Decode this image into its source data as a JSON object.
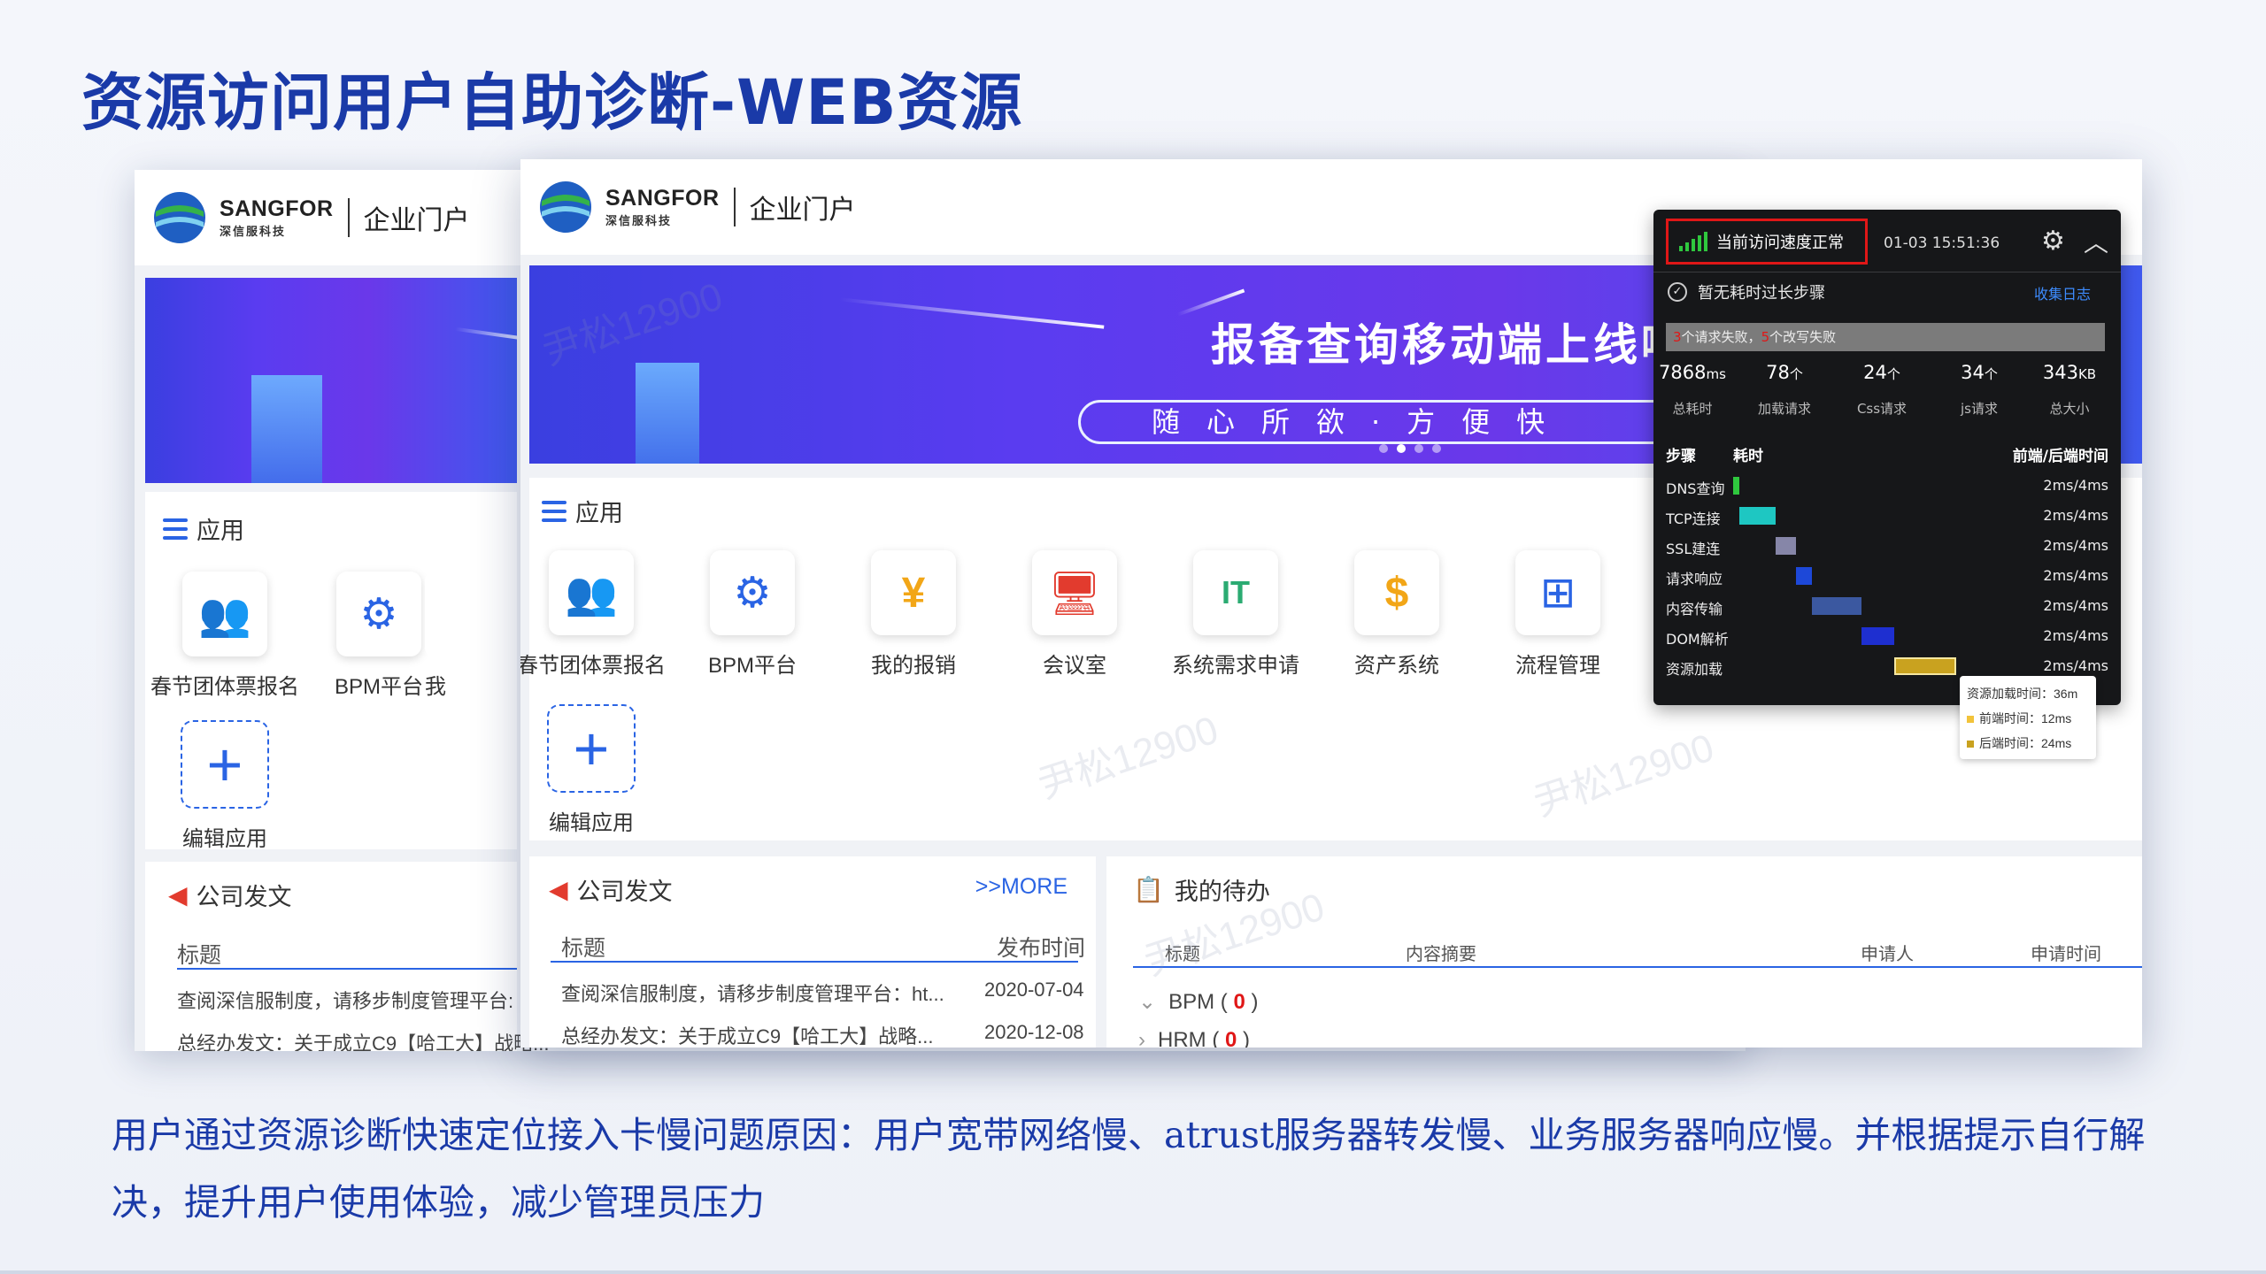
{
  "slide": {
    "title": "资源访问用户自助诊断-WEB资源",
    "caption": "用户通过资源诊断快速定位接入卡慢问题原因：用户宽带网络慢、atrust服务器转发慢、业务服务器响应慢。并根据提示自行解决，提升用户使用体验，减少管理员压力"
  },
  "portal": {
    "brand": "SANGFOR",
    "brand_cn": "深信服科技",
    "portal_name": "企业门户",
    "watermark": "尹松12900",
    "banner": {
      "headline": "报备查询移动端上线啦",
      "subline": "随心所欲·方便快"
    },
    "apps_title": "应用",
    "apps": [
      {
        "label": "春节团体票报名",
        "icon": "people-icon",
        "glyph": "👥",
        "color": "#2a64e4"
      },
      {
        "label": "BPM平台",
        "icon": "bpm-icon",
        "glyph": "⚙",
        "color": "#2a64e4"
      },
      {
        "label": "我的报销",
        "icon": "reimburse-icon",
        "glyph": "¥",
        "color": "#f2a617"
      },
      {
        "label": "会议室",
        "icon": "meeting-room-icon",
        "glyph": "🖥",
        "color": "#e23b2e"
      },
      {
        "label": "系统需求申请",
        "icon": "it-request-icon",
        "glyph": "IT",
        "color": "#2bab72"
      },
      {
        "label": "资产系统",
        "icon": "asset-icon",
        "glyph": "$",
        "color": "#f2a617"
      },
      {
        "label": "流程管理",
        "icon": "workflow-icon",
        "glyph": "⊞",
        "color": "#2a64e4"
      }
    ],
    "edit_app_label": "编辑应用",
    "back_apps": [
      "春节团体票报名",
      "BPM平台",
      "我"
    ],
    "notice": {
      "title": "公司发文",
      "more": ">>MORE",
      "col_title": "标题",
      "col_time": "发布时间",
      "rows": [
        {
          "title": "查阅深信服制度，请移步制度管理平台：ht...",
          "time": "2020-07-04"
        },
        {
          "title": "总经办发文：关于成立C9【哈工大】战略...",
          "time": "2020-12-08"
        }
      ],
      "back_rows": [
        "查阅深信服制度，请移步制度管理平台:",
        "总经办发文：关于成立C9【哈工大】战略..."
      ]
    },
    "todo": {
      "title": "我的待办",
      "columns": [
        "标题",
        "内容摘要",
        "申请人",
        "申请时间"
      ],
      "groups": [
        {
          "name": "BPM",
          "count": "0"
        },
        {
          "name": "HRM",
          "count": "0"
        }
      ]
    }
  },
  "diag": {
    "status": "当前访问速度正常",
    "time": "01-03 15:51:36",
    "no_slow": "暂无耗时过长步骤",
    "collect_log": "收集日志",
    "fail_req_count": "3",
    "fail_req_text": "个请求失败，",
    "fail_rewrite_count": "5",
    "fail_rewrite_text": "个改写失败",
    "stats": [
      {
        "value": "7868",
        "unit": "ms",
        "label": "总耗时"
      },
      {
        "value": "78",
        "unit": "个",
        "label": "加载请求"
      },
      {
        "value": "24",
        "unit": "个",
        "label": "Css请求"
      },
      {
        "value": "34",
        "unit": "个",
        "label": "js请求"
      },
      {
        "value": "343",
        "unit": "KB",
        "label": "总大小"
      }
    ],
    "col_step": "步骤",
    "col_cost": "耗时",
    "col_fb": "前端/后端时间",
    "steps": [
      {
        "name": "DNS查询",
        "time": "2ms/4ms",
        "color": "#2fc83e",
        "start": 0.0,
        "width": 0.02
      },
      {
        "name": "TCP连接",
        "time": "2ms/4ms",
        "color": "#1ec7c2",
        "start": 0.02,
        "width": 0.11
      },
      {
        "name": "SSL建连",
        "time": "2ms/4ms",
        "color": "#8686a8",
        "start": 0.13,
        "width": 0.06
      },
      {
        "name": "请求响应",
        "time": "2ms/4ms",
        "color": "#1d48d8",
        "start": 0.19,
        "width": 0.05
      },
      {
        "name": "内容传输",
        "time": "2ms/4ms",
        "color": "#3b58a0",
        "start": 0.24,
        "width": 0.15
      },
      {
        "name": "DOM解析",
        "time": "2ms/4ms",
        "color": "#1e2fd0",
        "start": 0.39,
        "width": 0.1
      },
      {
        "name": "资源加载",
        "time": "2ms/4ms",
        "color": "#c9a21f",
        "start": 0.49,
        "width": 0.19
      }
    ],
    "tooltip": {
      "total": "资源加载时间：36m",
      "front": "前端时间：12ms",
      "back": "后端时间：24ms"
    }
  }
}
